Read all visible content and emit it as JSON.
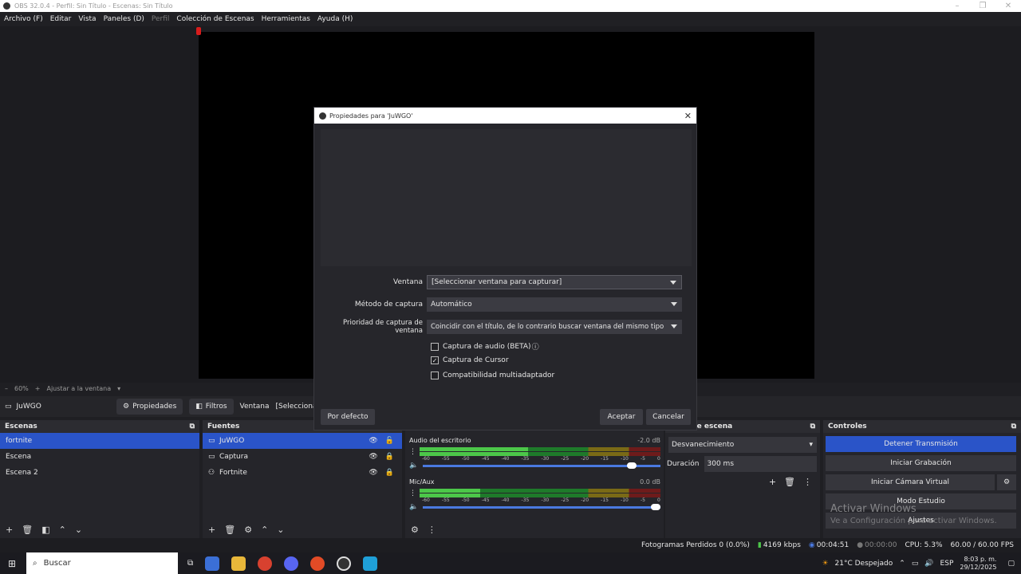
{
  "window": {
    "title": "OBS 32.0.4 - Perfil: Sin Título - Escenas: Sin Título",
    "controls": [
      "–",
      "❐",
      "✕"
    ]
  },
  "menu": {
    "items": [
      "Archivo (F)",
      "Editar",
      "Vista",
      "Paneles (D)",
      "Perfil",
      "Colección de Escenas",
      "Herramientas",
      "Ayuda (H)"
    ]
  },
  "zoombar": {
    "minus": "–",
    "zoom": "60%",
    "plus": "+",
    "fit": "Ajustar a la ventana"
  },
  "sourcebar": {
    "source_name": "JuWGO",
    "properties": "Propiedades",
    "filters": "Filtros",
    "window_label": "Ventana",
    "window_value": "[Seleccionar ve"
  },
  "scenes": {
    "title": "Escenas",
    "items": [
      "fortnite",
      "Escena",
      "Escena 2"
    ]
  },
  "sources": {
    "title": "Fuentes",
    "items": [
      "JuWGO",
      "Captura",
      "Fortnite"
    ]
  },
  "mixer": {
    "tracks": [
      {
        "name": "Audio del escritorio",
        "db": "-2.0 dB",
        "level": 0.45,
        "volume": 0.9
      },
      {
        "name": "Mic/Aux",
        "db": "0.0 dB",
        "level": 0.25,
        "volume": 1.0
      }
    ],
    "ticks": [
      "-60",
      "-55",
      "-50",
      "-45",
      "-40",
      "-35",
      "-30",
      "-25",
      "-20",
      "-15",
      "-10",
      "-5",
      "0"
    ]
  },
  "transitions": {
    "title": "ones de escena",
    "type": "Desvanecimiento",
    "duration_label": "Duración",
    "duration_value": "300 ms"
  },
  "controls": {
    "title": "Controles",
    "buttons": [
      "Detener Transmisión",
      "Iniciar Grabación",
      "Iniciar Cámara Virtual",
      "Modo Estudio",
      "Ajustes"
    ]
  },
  "watermark": {
    "line1": "Activar Windows",
    "line2": "Ve a Configuración para activar Windows."
  },
  "status": {
    "dropped": "Fotogramas Perdidos 0 (0.0%)",
    "bitrate": "4169 kbps",
    "stream_time": "00:04:51",
    "rec_time": "00:00:00",
    "cpu": "CPU: 5.3%",
    "fps": "60.00 / 60.00 FPS"
  },
  "taskbar": {
    "search_placeholder": "Buscar",
    "weather": "21°C  Despejado",
    "lang": "ESP",
    "time": "8:03 p. m.",
    "date": "29/12/2025"
  },
  "dialog": {
    "title": "Propiedades para 'JuWGO'",
    "close": "✕",
    "fields": [
      {
        "label": "Ventana",
        "value": "[Seleccionar ventana para capturar]"
      },
      {
        "label": "Método de captura",
        "value": "Automático"
      },
      {
        "label": "Prioridad de captura de ventana",
        "value": "Coincidir con el título, de lo contrario buscar ventana del mismo tipo"
      }
    ],
    "checks": [
      {
        "label": "Captura de audio (BETA)",
        "checked": false
      },
      {
        "label": "Captura de Cursor",
        "checked": true
      },
      {
        "label": "Compatibilidad multiadaptador",
        "checked": false
      }
    ],
    "defaults_button": "Por defecto",
    "ok_button": "Aceptar",
    "cancel_button": "Cancelar"
  },
  "colors": {
    "accent": "#2a54c8",
    "meter_green": "#4cc749"
  }
}
